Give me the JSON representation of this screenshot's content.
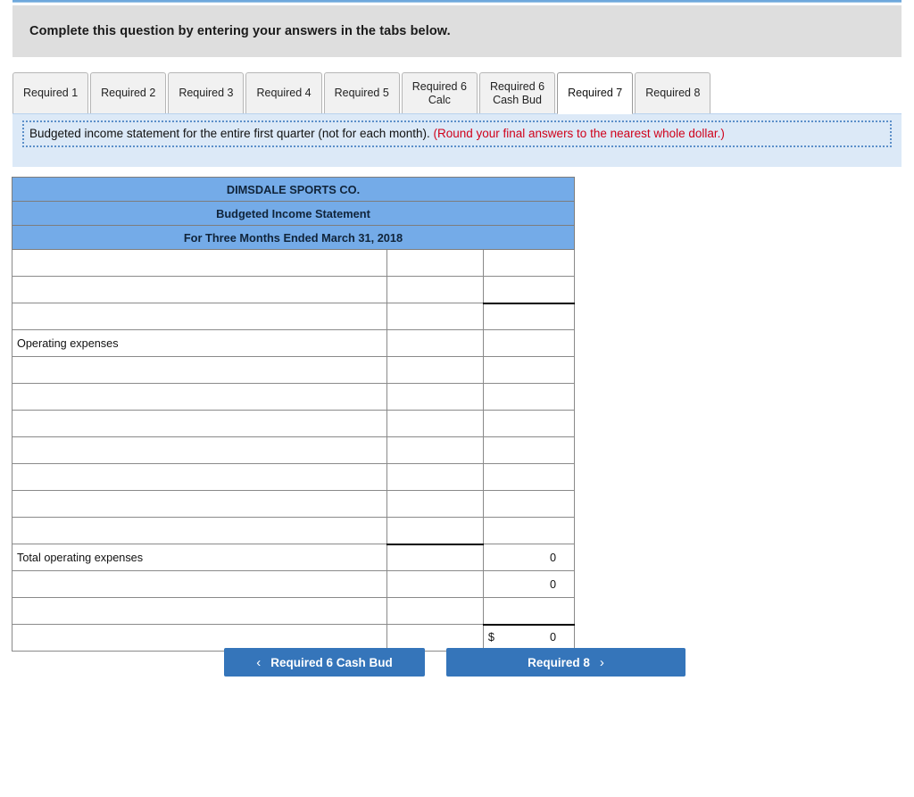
{
  "banner": {
    "text": "Complete this question by entering your answers in the tabs below."
  },
  "tabs": {
    "items": [
      {
        "label": "Required 1",
        "active": false
      },
      {
        "label": "Required 2",
        "active": false
      },
      {
        "label": "Required 3",
        "active": false
      },
      {
        "label": "Required 4",
        "active": false
      },
      {
        "label": "Required 5",
        "active": false
      },
      {
        "label": "Required 6\nCalc",
        "active": false
      },
      {
        "label": "Required 6\nCash Bud",
        "active": false
      },
      {
        "label": "Required 7",
        "active": true
      },
      {
        "label": "Required 8",
        "active": false
      }
    ]
  },
  "requirement": {
    "text": "Budgeted income statement for the entire first quarter (not for each month). ",
    "round_note": "(Round your final answers to the nearest whole dollar.)"
  },
  "statement": {
    "header_lines": [
      "DIMSDALE SPORTS CO.",
      "Budgeted Income Statement",
      "For Three Months Ended March 31, 2018"
    ],
    "rows": [
      {
        "label": "",
        "mid": "",
        "right": ""
      },
      {
        "label": "",
        "mid": "",
        "right": "",
        "right_rule": "bottom"
      },
      {
        "label": "",
        "mid": "",
        "right": ""
      },
      {
        "label": "Operating expenses",
        "mid": "",
        "right": ""
      },
      {
        "label": "",
        "mid": "",
        "right": ""
      },
      {
        "label": "",
        "mid": "",
        "right": ""
      },
      {
        "label": "",
        "mid": "",
        "right": ""
      },
      {
        "label": "",
        "mid": "",
        "right": ""
      },
      {
        "label": "",
        "mid": "",
        "right": ""
      },
      {
        "label": "",
        "mid": "",
        "right": ""
      },
      {
        "label": "",
        "mid": "",
        "right": "",
        "mid_rule": "bottom"
      },
      {
        "label": "Total operating expenses",
        "mid": "",
        "right": "0"
      },
      {
        "label": "",
        "mid": "",
        "right": "0"
      },
      {
        "label": "",
        "mid": "",
        "right": ""
      },
      {
        "label": "",
        "mid": "",
        "right": "0",
        "right_dollar": "$",
        "right_rule": "top-double"
      }
    ]
  },
  "nav": {
    "prev_label": "Required 6 Cash Bud",
    "next_label": "Required 8",
    "prev_icon": "chevron-left-icon",
    "next_icon": "chevron-right-icon",
    "prev_chevron": "‹",
    "next_chevron": "›"
  },
  "colors": {
    "header_blue": "#74abe8",
    "button_blue": "#3575ba",
    "banner_grey": "#dedede",
    "req_blue": "#dce9f7",
    "round_red": "#d0021b"
  }
}
